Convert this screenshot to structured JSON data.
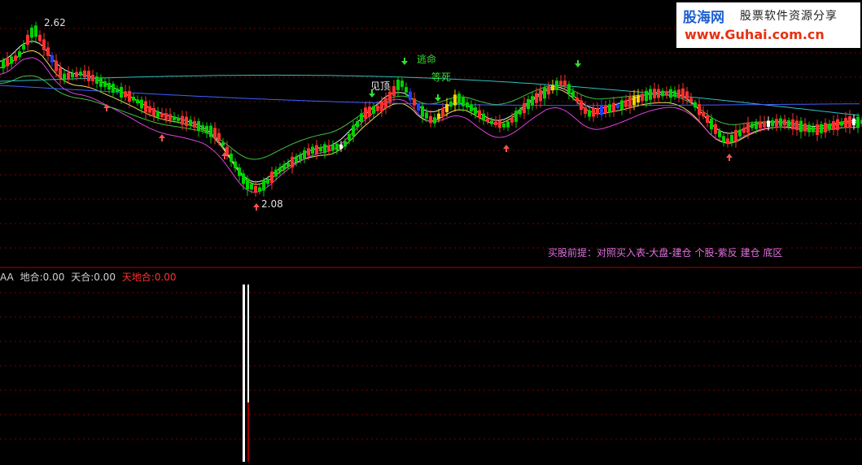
{
  "watermark": {
    "brand": "股海网",
    "slogan": "股票软件资源分享",
    "url": "www.Guhai.com.cn"
  },
  "price_labels": {
    "high": "2.62",
    "low": "2.08"
  },
  "signals": {
    "escape": "逃命",
    "wait_death": "等死",
    "top": "见顶"
  },
  "note": "买股前提：对照买入表-大盘-建仓  个股-紫反 建仓 底区",
  "indicator": {
    "name": "AA",
    "items": [
      {
        "label": "地合:",
        "value": "0.00"
      },
      {
        "label": "天合:",
        "value": "0.00"
      },
      {
        "label": "天地合:",
        "value": "0.00"
      }
    ]
  },
  "colors": {
    "up": "#ff3030",
    "down": "#00d000",
    "special_blue": "#2040ff",
    "special_yellow": "#ffd000",
    "special_white": "#ffffff",
    "ma_white": "#f0f0f0",
    "ma_yellow": "#f0e060",
    "ma_magenta": "#e040e0",
    "ma_green": "#40c040",
    "ma_cyan": "#30c0c0",
    "ma_blue": "#4060ff",
    "grid": "#7a0000",
    "signal_green": "#30e030",
    "note": "#e070e0"
  }
}
